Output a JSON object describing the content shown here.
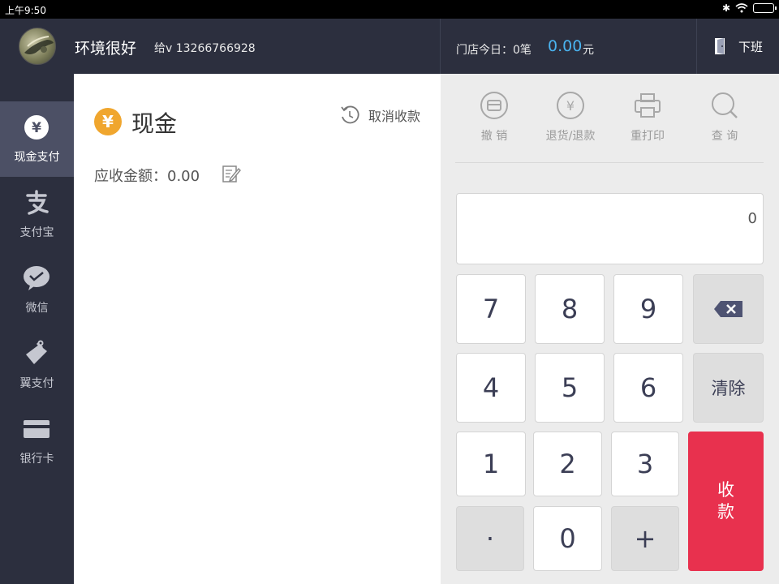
{
  "status_bar": {
    "time": "上午9:50",
    "bluetooth": "✱"
  },
  "header": {
    "store_name": "环境很好",
    "account": "给v 13266766928",
    "today_label": "门店今日：0笔",
    "today_amount": "0.00",
    "today_unit": "元",
    "logout_label": "下班"
  },
  "sidebar": {
    "items": [
      {
        "label": "现金支付",
        "icon": "yuan-coin-icon",
        "active": true
      },
      {
        "label": "支付宝",
        "icon": "alipay-icon"
      },
      {
        "label": "微信",
        "icon": "wechat-icon"
      },
      {
        "label": "翼支付",
        "icon": "wallet-icon"
      },
      {
        "label": "银行卡",
        "icon": "bank-card-icon"
      }
    ]
  },
  "main": {
    "cash_symbol": "¥",
    "title": "现金",
    "cancel_label": "取消收款",
    "amount_due_label": "应收金额：0.00"
  },
  "toolbar": {
    "items": [
      {
        "label": "撤 销",
        "icon": "revoke-icon"
      },
      {
        "label": "退货/退款",
        "icon": "refund-icon"
      },
      {
        "label": "重打印",
        "icon": "printer-icon"
      },
      {
        "label": "查 询",
        "icon": "search-icon"
      }
    ]
  },
  "display": {
    "value": "0"
  },
  "keypad": {
    "k7": "7",
    "k8": "8",
    "k9": "9",
    "k4": "4",
    "k5": "5",
    "k6": "6",
    "k1": "1",
    "k2": "2",
    "k3": "3",
    "dot": "·",
    "k0": "0",
    "plus": "+",
    "clear": "清除",
    "pay_line1": "收",
    "pay_line2": "款"
  },
  "colors": {
    "accent_blue": "#4ab4f0",
    "pay_red": "#e8314e",
    "cash_orange": "#f0a62e",
    "sidebar_bg": "#2c2f3e"
  }
}
